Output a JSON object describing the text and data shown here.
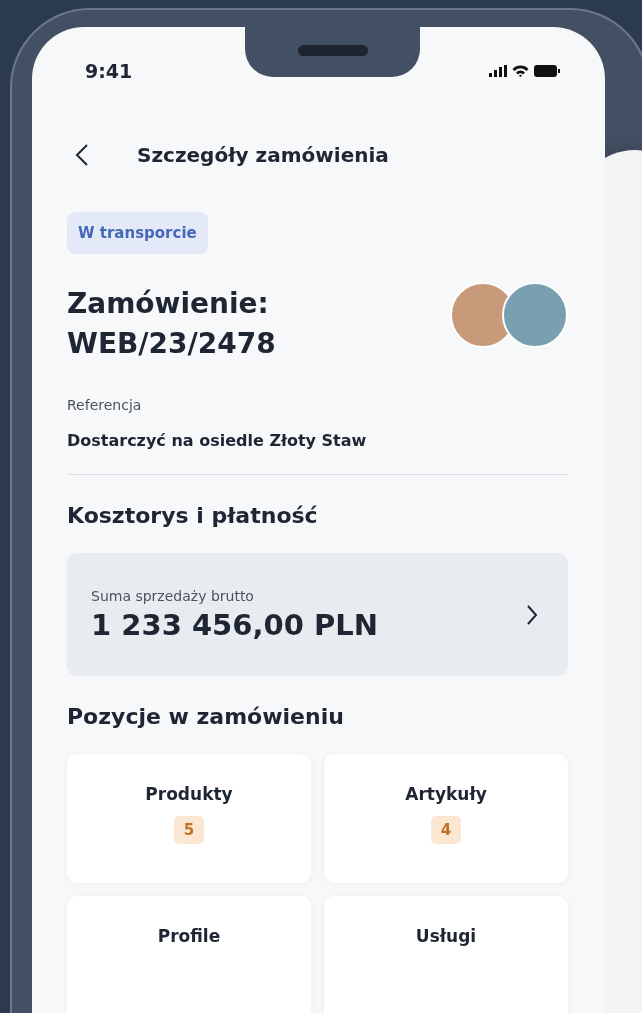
{
  "status_bar": {
    "time": "9:41"
  },
  "header": {
    "title": "Szczegóły zamówienia"
  },
  "order": {
    "status": "W transporcie",
    "title_label": "Zamówienie:",
    "number": "WEB/23/2478",
    "reference_label": "Referencja",
    "reference": "Dostarczyć na osiedle Złoty Staw"
  },
  "costs": {
    "heading": "Kosztorys i płatność",
    "label": "Suma sprzedaży brutto",
    "amount": "1 233 456,00 PLN"
  },
  "items": {
    "heading": "Pozycje w zamówieniu",
    "tiles": [
      {
        "label": "Produkty",
        "count": "5"
      },
      {
        "label": "Artykuły",
        "count": "4"
      },
      {
        "label": "Profile"
      },
      {
        "label": "Usługi"
      }
    ]
  }
}
